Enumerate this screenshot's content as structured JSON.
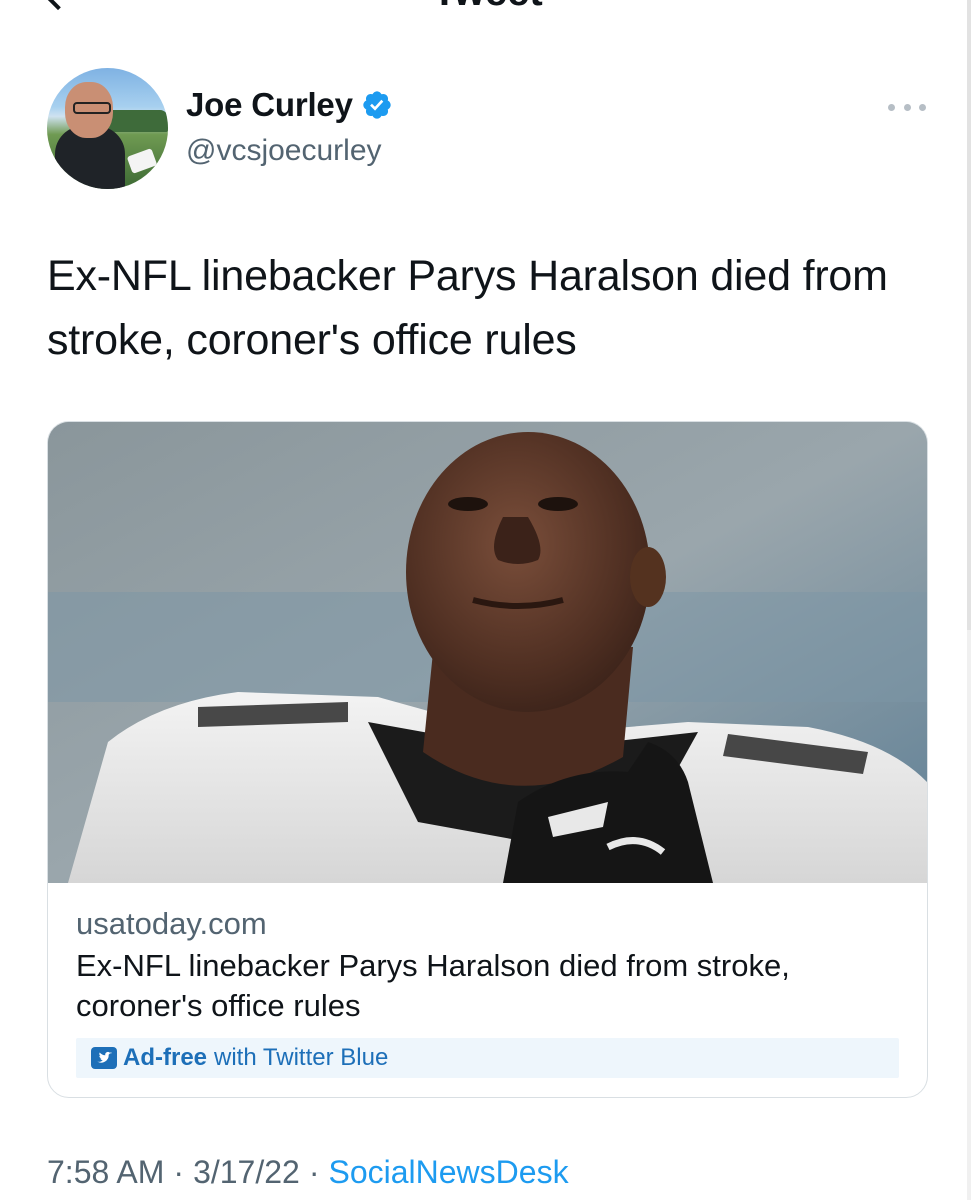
{
  "nav": {
    "title": "Tweet"
  },
  "author": {
    "display_name": "Joe Curley",
    "handle": "@vcsjoecurley",
    "verified": true
  },
  "tweet": {
    "text": "Ex-NFL linebacker Parys Haralson died from stroke, coroner's office rules"
  },
  "link_card": {
    "domain": "usatoday.com",
    "title": "Ex-NFL linebacker Parys Haralson died from stroke, coroner's office rules",
    "promo_strong": "Ad-free",
    "promo_rest": "with Twitter Blue"
  },
  "meta": {
    "time": "7:58 AM",
    "separator": "·",
    "date": "3/17/22",
    "source": "SocialNewsDesk"
  },
  "colors": {
    "text_primary": "#0f1419",
    "text_secondary": "#536471",
    "link_blue": "#1d9bf0",
    "verified_blue": "#1d9bf0",
    "promo_bg": "#eef6fc"
  },
  "icons": {
    "back": "chevron-left-icon",
    "more": "more-horizontal-icon",
    "verified": "verified-badge-icon",
    "twitter_blue": "twitter-blue-bird-icon"
  }
}
